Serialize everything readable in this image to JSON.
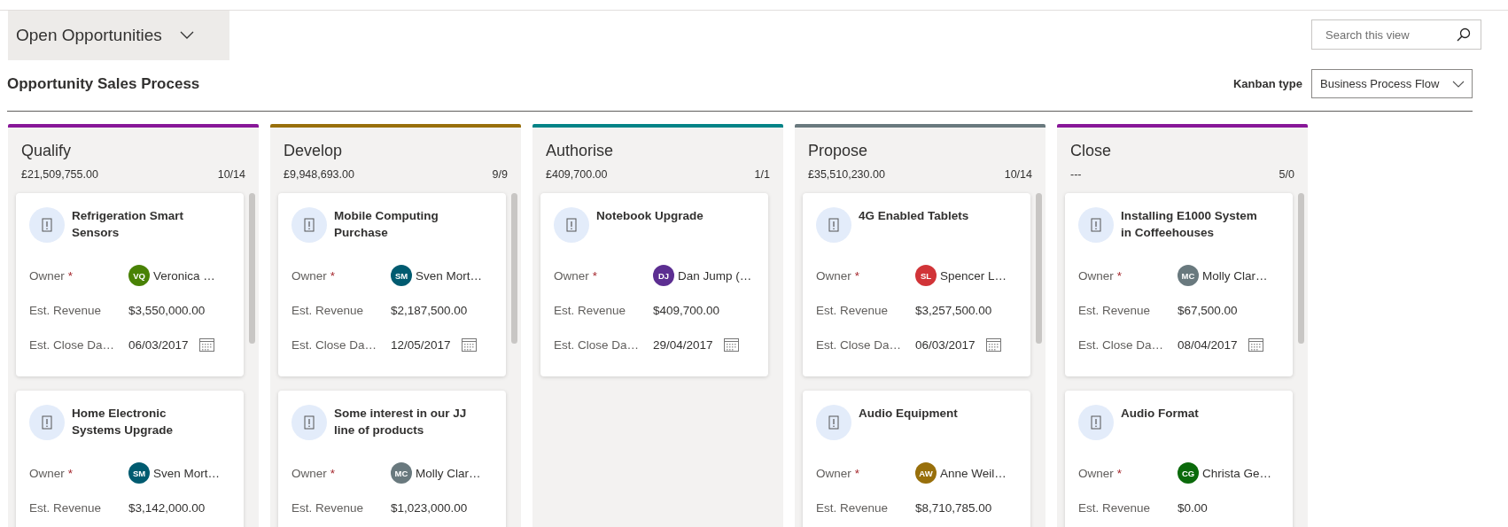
{
  "view_selector": {
    "title": "Open Opportunities"
  },
  "search": {
    "placeholder": "Search this view"
  },
  "process_title": "Opportunity Sales Process",
  "kanban_type": {
    "label": "Kanban type",
    "value": "Business Process Flow"
  },
  "columns": [
    {
      "title": "Qualify",
      "color": "#881798",
      "total": "£21,509,755.00",
      "count": "10/14",
      "cards": [
        {
          "title": "Refrigeration Smart Sensors",
          "fields": [
            {
              "kind": "owner",
              "label": "Owner",
              "required_mark": "*",
              "initials": "VQ",
              "color": "#498205",
              "value": "Veronica …"
            },
            {
              "kind": "text",
              "label": "Est. Revenue",
              "value": "$3,550,000.00"
            },
            {
              "kind": "date",
              "label": "Est. Close Da…",
              "value": "06/03/2017"
            }
          ]
        },
        {
          "title": "Home Electronic Systems Upgrade",
          "fields": [
            {
              "kind": "owner",
              "label": "Owner",
              "required_mark": "*",
              "initials": "SM",
              "color": "#005b70",
              "value": "Sven Mort…"
            },
            {
              "kind": "text",
              "label": "Est. Revenue",
              "value": "$3,142,000.00"
            }
          ]
        }
      ]
    },
    {
      "title": "Develop",
      "color": "#986f0b",
      "total": "£9,948,693.00",
      "count": "9/9",
      "cards": [
        {
          "title": "Mobile Computing Purchase",
          "fields": [
            {
              "kind": "owner",
              "label": "Owner",
              "required_mark": "*",
              "initials": "SM",
              "color": "#005b70",
              "value": "Sven Mort…"
            },
            {
              "kind": "text",
              "label": "Est. Revenue",
              "value": "$2,187,500.00"
            },
            {
              "kind": "date",
              "label": "Est. Close Da…",
              "value": "12/05/2017"
            }
          ]
        },
        {
          "title": "Some interest in our JJ line of products",
          "fields": [
            {
              "kind": "owner",
              "label": "Owner",
              "required_mark": "*",
              "initials": "MC",
              "color": "#69797e",
              "value": "Molly Clar…"
            },
            {
              "kind": "text",
              "label": "Est. Revenue",
              "value": "$1,023,000.00"
            }
          ]
        }
      ]
    },
    {
      "title": "Authorise",
      "color": "#038387",
      "total": "£409,700.00",
      "count": "1/1",
      "cards": [
        {
          "title": "Notebook Upgrade",
          "fields": [
            {
              "kind": "owner",
              "label": "Owner",
              "required_mark": "*",
              "initials": "DJ",
              "color": "#5c2e91",
              "value": "Dan Jump (…"
            },
            {
              "kind": "text",
              "label": "Est. Revenue",
              "value": "$409,700.00"
            },
            {
              "kind": "date",
              "label": "Est. Close Da…",
              "value": "29/04/2017"
            }
          ]
        }
      ]
    },
    {
      "title": "Propose",
      "color": "#69797e",
      "total": "£35,510,230.00",
      "count": "10/14",
      "cards": [
        {
          "title": "4G Enabled Tablets",
          "fields": [
            {
              "kind": "owner",
              "label": "Owner",
              "required_mark": "*",
              "initials": "SL",
              "color": "#d13438",
              "value": "Spencer L…"
            },
            {
              "kind": "text",
              "label": "Est. Revenue",
              "value": "$3,257,500.00"
            },
            {
              "kind": "date",
              "label": "Est. Close Da…",
              "value": "06/03/2017"
            }
          ]
        },
        {
          "title": "Audio Equipment",
          "fields": [
            {
              "kind": "owner",
              "label": "Owner",
              "required_mark": "*",
              "initials": "AW",
              "color": "#986f0b",
              "value": "Anne Weil…"
            },
            {
              "kind": "text",
              "label": "Est. Revenue",
              "value": "$8,710,785.00"
            }
          ]
        }
      ]
    },
    {
      "title": "Close",
      "color": "#881798",
      "total": "---",
      "count": "5/0",
      "cards": [
        {
          "title": "Installing E1000 System in Coffeehouses",
          "fields": [
            {
              "kind": "owner",
              "label": "Owner",
              "required_mark": "*",
              "initials": "MC",
              "color": "#69797e",
              "value": "Molly Clar…"
            },
            {
              "kind": "text",
              "label": "Est. Revenue",
              "value": "$67,500.00"
            },
            {
              "kind": "date",
              "label": "Est. Close Da…",
              "value": "08/04/2017"
            }
          ]
        },
        {
          "title": "Audio Format",
          "fields": [
            {
              "kind": "owner",
              "label": "Owner",
              "required_mark": "*",
              "initials": "CG",
              "color": "#0b6a0b",
              "value": "Christa Ge…"
            },
            {
              "kind": "text",
              "label": "Est. Revenue",
              "value": "$0.00"
            }
          ]
        }
      ]
    }
  ]
}
